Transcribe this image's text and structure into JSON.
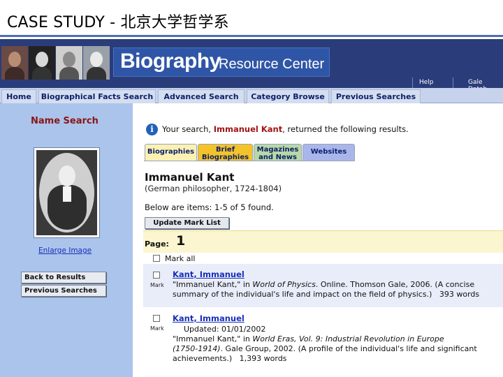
{
  "slide": {
    "title": "CASE STUDY - 北京大学哲学系"
  },
  "banner": {
    "brand_big": "Biography",
    "brand_small": "Resource Center",
    "util_links": [
      "Help",
      "Gale Datab"
    ]
  },
  "nav": {
    "tabs": [
      "Home",
      "Biographical Facts Search",
      "Advanced Search",
      "Category Browse",
      "Previous Searches"
    ]
  },
  "sidebar": {
    "heading": "Name Search",
    "enlarge_link": "Enlarge Image",
    "back_button": "Back to Results",
    "previous_button": "Previous Searches"
  },
  "main": {
    "result_prefix": "Your search,",
    "result_query": "Immanuel Kant",
    "result_suffix": ", returned the following results.",
    "tabs": [
      {
        "line1": "Biographies",
        "line2": "",
        "color": "#fbf1b3"
      },
      {
        "line1": "Brief",
        "line2": "Biographies",
        "color": "#f3c329"
      },
      {
        "line1": "Magazines",
        "line2": "and News",
        "color": "#b8d8a6"
      },
      {
        "line1": "Websites",
        "line2": "",
        "color": "#aab6ea"
      }
    ],
    "person_name": "Immanuel Kant",
    "person_desc": "(German philosopher, 1724-1804)",
    "items_found": "Below are items: 1-5 of 5 found.",
    "update_button": "Update Mark List",
    "page_label": "Page:",
    "page_number": "1",
    "mark_all": "Mark all",
    "mark_label": "Mark",
    "results": [
      {
        "title": "Kant, Immanuel",
        "line1_a": "\"Immanuel Kant,\" in ",
        "line1_b": "World of Physics",
        "line1_c": ". Online. Thomson Gale, 2006. (A concise",
        "line2": "summary of the individual's life and impact on the field of physics.)",
        "words": "393 words"
      },
      {
        "title": "Kant, Immanuel",
        "updated": "Updated: 01/01/2002",
        "line1_a": "\"Immanuel Kant,\" in ",
        "line1_b": "World Eras, Vol. 9: Industrial Revolution in Europe",
        "line2_b": "(1750-1914)",
        "line2_c": ". Gale Group, 2002. (A profile of the individual's life and significant",
        "line3": "achievements.)",
        "words": "1,393 words"
      }
    ]
  }
}
